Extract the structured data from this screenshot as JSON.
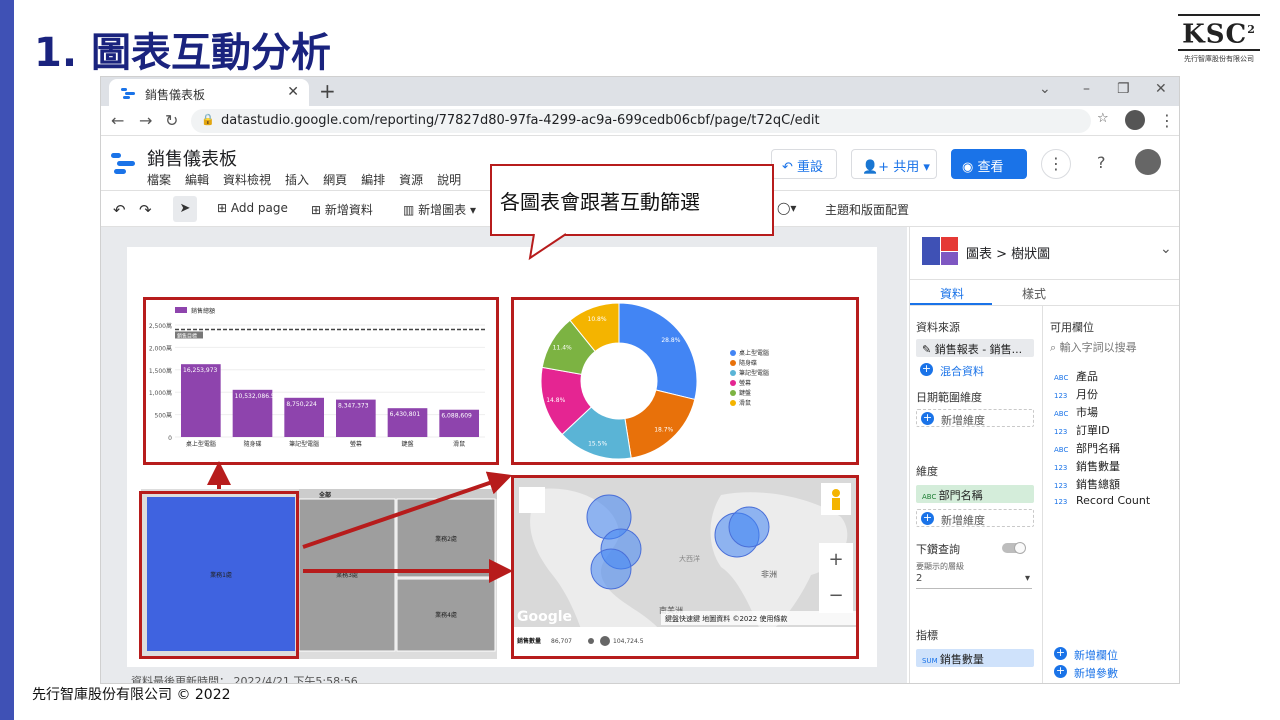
{
  "slide": {
    "title": "1. 圖表互動分析",
    "logo_text": "KSC",
    "logo_sup": "2",
    "logo_sub": "先行智庫股份有限公司",
    "footer": "先行智庫股份有限公司 © 2022",
    "callout": "各圖表會跟著互動篩選",
    "accent_color": "#1a237e",
    "highlight_color": "#b71c1c"
  },
  "browser": {
    "tab_title": "銷售儀表板",
    "url": "datastudio.google.com/reporting/77827d80-97fa-4299-ac9a-699cedb06cbf/page/t72qC/edit"
  },
  "app": {
    "title": "銷售儀表板",
    "menus": [
      "檔案",
      "編輯",
      "資料檢視",
      "插入",
      "網頁",
      "編排",
      "資源",
      "說明"
    ],
    "reset_label": "重設",
    "share_label": "共用",
    "view_label": "查看"
  },
  "toolbar": {
    "add_page": "Add page",
    "add_data": "新增資料",
    "add_chart": "新增圖表",
    "theme": "主題和版面配置"
  },
  "panel": {
    "breadcrumb": "圖表 > 樹狀圖",
    "tab_data": "資料",
    "tab_style": "樣式",
    "datasource_label": "資料來源",
    "datasource_value": "銷售報表 - 銷售...",
    "blend": "混合資料",
    "date_range_label": "日期範圍維度",
    "add_dimension": "新增維度",
    "dimension_label": "維度",
    "dimension_value": "部門名稱",
    "drilldown_label": "下鑽查詢",
    "drill_levels_label": "要顯示的層級",
    "drill_levels_value": "2",
    "metric_label": "指標",
    "metric_value": "銷售數量",
    "metric_agg": "SUM",
    "available_label": "可用欄位",
    "search_placeholder": "輸入字詞以搜尋",
    "fields": [
      {
        "type": "ABC",
        "name": "產品"
      },
      {
        "type": "123",
        "name": "月份"
      },
      {
        "type": "ABC",
        "name": "市場"
      },
      {
        "type": "123",
        "name": "訂單ID"
      },
      {
        "type": "ABC",
        "name": "部門名稱"
      },
      {
        "type": "123",
        "name": "銷售數量"
      },
      {
        "type": "123",
        "name": "銷售總額"
      },
      {
        "type": "123",
        "name": "Record Count"
      }
    ],
    "add_field": "新增欄位",
    "add_param": "新增參數"
  },
  "canvas": {
    "last_updated": "資料最後更新時間： 2022/4/21 下午5:58:56"
  },
  "chart_data": [
    {
      "type": "bar",
      "legend": "銷售總額",
      "reference_label": "銷售目標",
      "reference_value": 2400,
      "categories": [
        "桌上型電腦",
        "隨身碟",
        "筆記型電腦",
        "螢幕",
        "鍵盤",
        "滑鼠"
      ],
      "values": [
        16253973,
        10532086.5,
        8750224,
        8347373,
        6430801,
        6088609
      ],
      "value_labels": [
        "16,253,973",
        "10,532,086.5",
        "8,750,224",
        "8,347,373",
        "6,430,801",
        "6,088,609"
      ],
      "y_ticks": [
        "2,500萬",
        "2,000萬",
        "1,500萬",
        "1,000萬",
        "500萬",
        "0"
      ],
      "ylim": [
        0,
        25000000
      ],
      "color": "#8e44ad"
    },
    {
      "type": "pie",
      "donut": true,
      "labels": [
        "桌上型電腦",
        "隨身碟",
        "筆記型電腦",
        "螢幕",
        "鍵盤",
        "滑鼠"
      ],
      "values": [
        28.8,
        18.7,
        15.5,
        14.8,
        11.4,
        10.8
      ],
      "value_labels": [
        "28.8%",
        "18.7%",
        "15.5%",
        "14.8%",
        "11.4%",
        "10.8%"
      ],
      "colors": [
        "#4285f4",
        "#e8710a",
        "#5ab4d6",
        "#e52592",
        "#7cb342",
        "#f4b400"
      ],
      "legend": "right"
    },
    {
      "type": "treemap",
      "root": "全部",
      "labels": [
        "業務1處",
        "業務3處",
        "業務2處",
        "業務4處"
      ]
    },
    {
      "type": "bubble-map",
      "places": [
        "非洲",
        "南美洲",
        "大西洋"
      ],
      "attribution": "Google",
      "map_footer": "鍵盤快速鍵  地圖資料 ©2022  使用條款",
      "size_label": "銷售數量",
      "size_min": "86,707",
      "size_max": "104,724.5"
    }
  ]
}
